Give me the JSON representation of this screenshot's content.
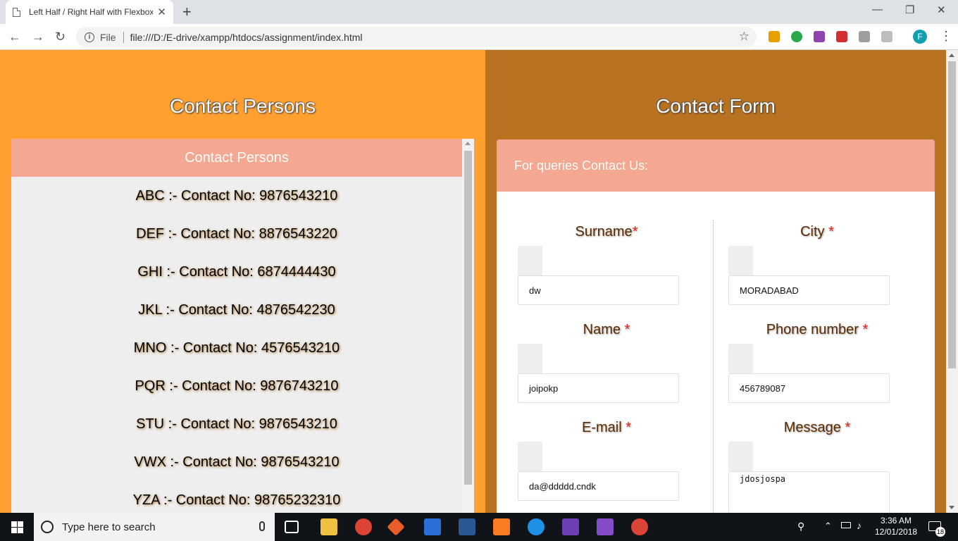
{
  "browser": {
    "tab_title": "Left Half / Right Half with Flexbox",
    "tab_close": "✕",
    "new_tab": "+",
    "url_file_label": "File",
    "url": "file:///D:/E-drive/xampp/htdocs/assignment/index.html",
    "profile_initial": "F"
  },
  "left": {
    "title": "Contact Persons",
    "box_header": "Contact Persons",
    "persons": [
      "ABC :- Contact No: 9876543210",
      "DEF :- Contact No: 8876543220",
      "GHI :- Contact No: 6874444430",
      "JKL :- Contact No: 4876542230",
      "MNO :- Contact No: 4576543210",
      "PQR :- Contact No: 9876743210",
      "STU :- Contact No: 9876543210",
      "VWX :- Contact No: 9876543210",
      "YZA :- Contact No: 98765232310"
    ]
  },
  "right": {
    "title": "Contact Form",
    "form_header": "For queries Contact Us:",
    "fields": {
      "surname": {
        "label": "Surname",
        "required": "*",
        "value": "dw"
      },
      "city": {
        "label": "City ",
        "required": "*",
        "value": "MORADABAD"
      },
      "name": {
        "label": "Name ",
        "required": "*",
        "value": "joipokp"
      },
      "phone": {
        "label": "Phone number ",
        "required": "*",
        "value": "456789087"
      },
      "email": {
        "label": "E-mail ",
        "required": "*",
        "value": "da@ddddd.cndk"
      },
      "message": {
        "label": "Message ",
        "required": "*",
        "value": "jdosjospa"
      }
    }
  },
  "taskbar": {
    "search_placeholder": "Type here to search",
    "time": "3:36 AM",
    "date": "12/01/2018",
    "notification_count": "18"
  }
}
